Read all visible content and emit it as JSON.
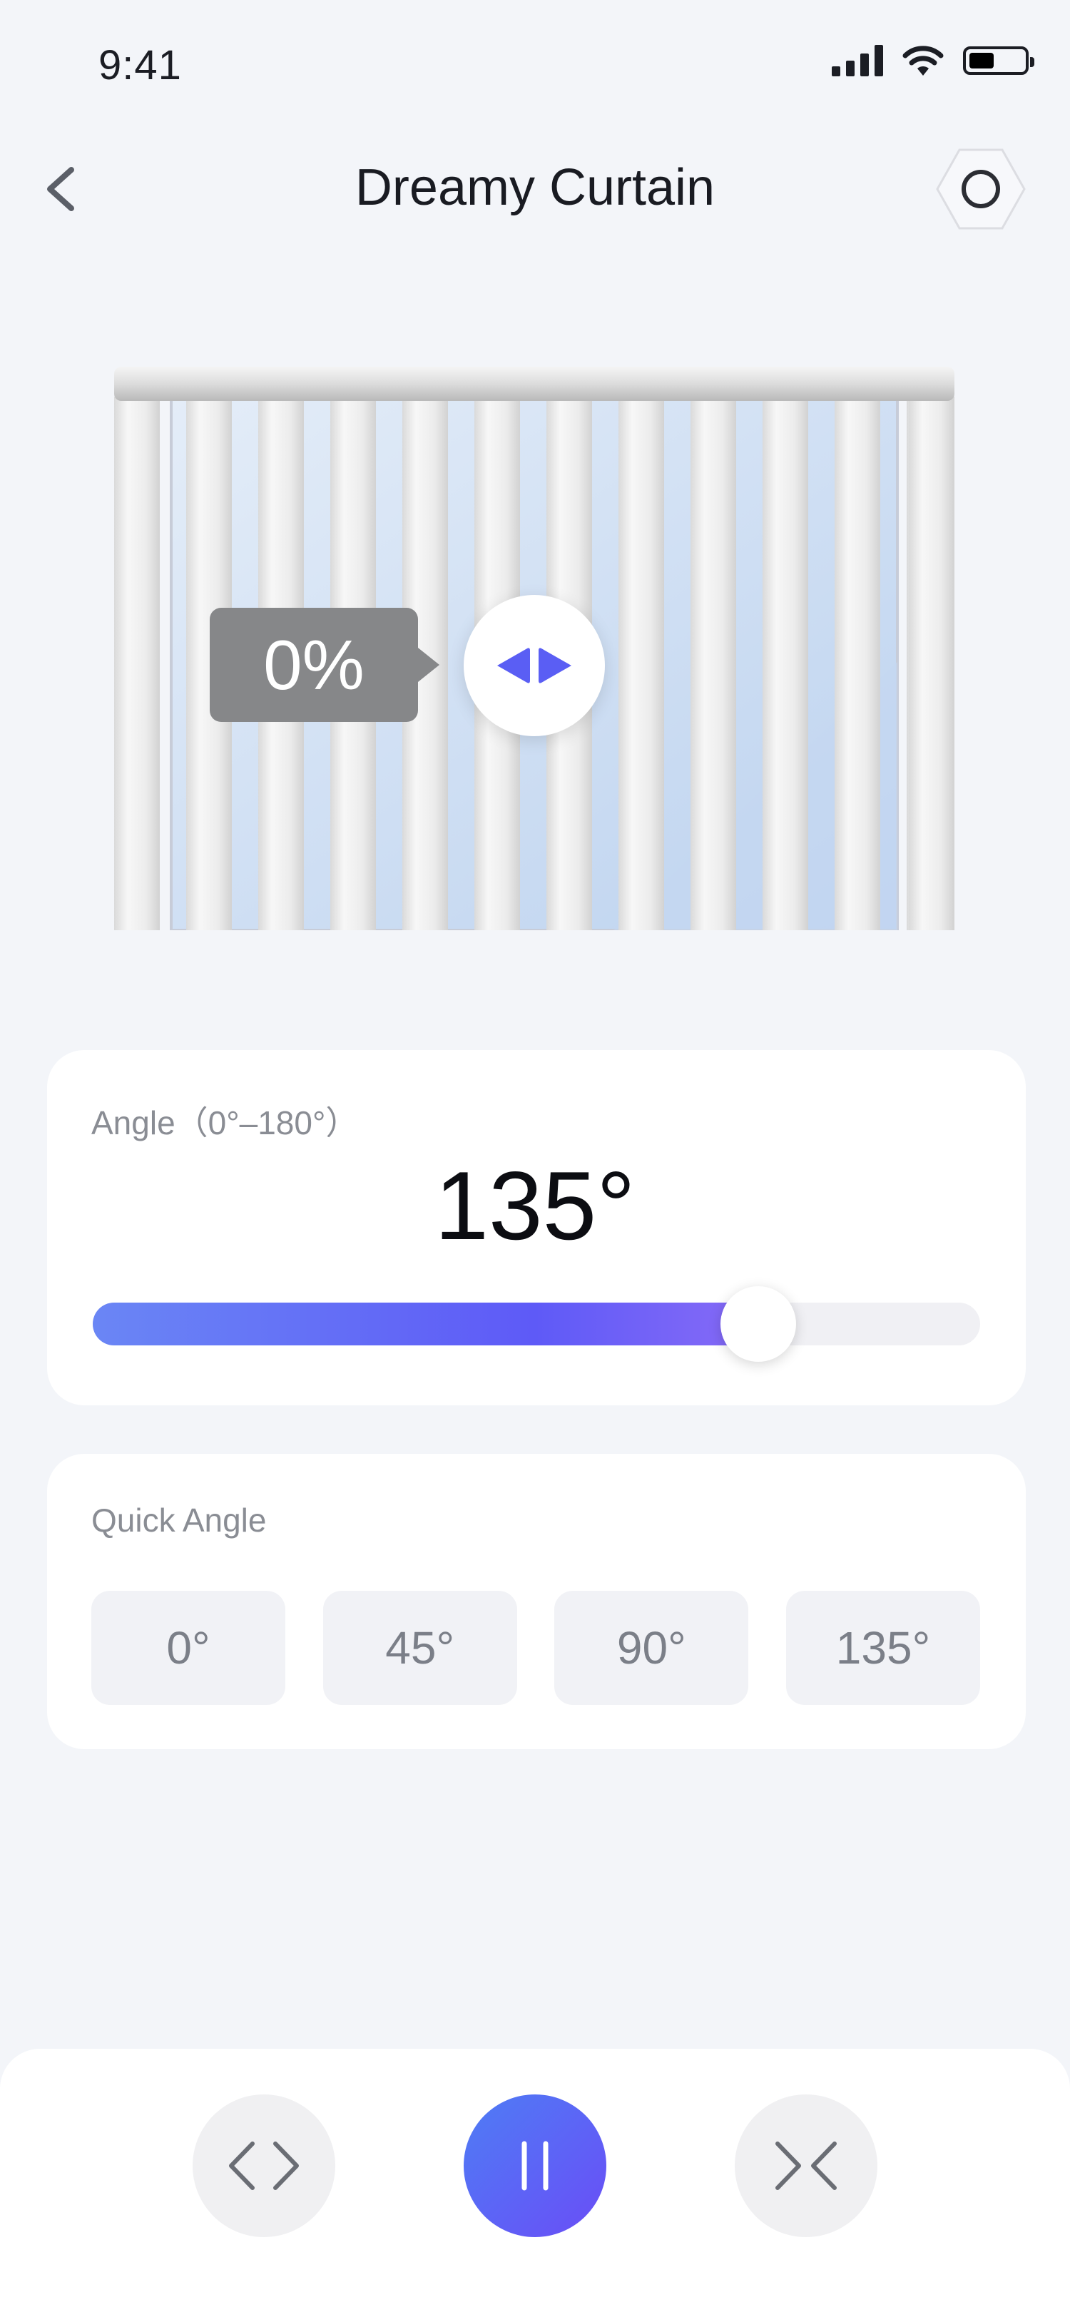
{
  "status_bar": {
    "time": "9:41"
  },
  "header": {
    "title": "Dreamy Curtain"
  },
  "curtain": {
    "open_percent_text": "0%",
    "open_percent": 0
  },
  "angle": {
    "label": "Angle（0°–180°）",
    "value_text": "135°",
    "value": 135,
    "min": 0,
    "max": 180
  },
  "quick_angle": {
    "label": "Quick Angle",
    "options": [
      "0°",
      "45°",
      "90°",
      "135°"
    ]
  },
  "controls": {
    "open_icon": "expand-arrows-icon",
    "pause_icon": "pause-icon",
    "close_icon": "collapse-arrows-icon"
  },
  "colors": {
    "accent_start": "#6a86f5",
    "accent_mid": "#5e5af7",
    "accent_end": "#8a6cf7",
    "background": "#f3f5f9"
  }
}
